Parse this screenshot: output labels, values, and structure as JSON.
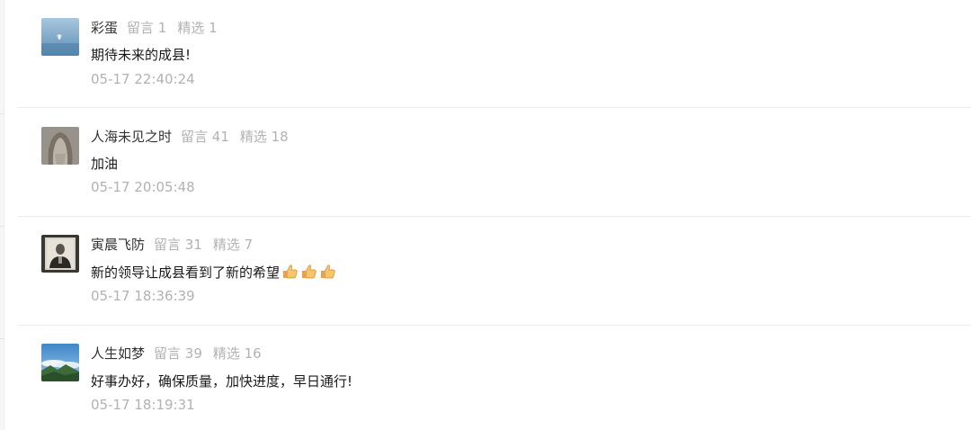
{
  "comments": [
    {
      "avatar_icon": "seagull-over-water-icon",
      "nickname": "彩蛋",
      "comment_count": "留言 1",
      "featured_count": "精选 1",
      "content": "期待未来的成县!",
      "time": "05-17 22:40:24"
    },
    {
      "avatar_icon": "long-hair-portrait-icon",
      "nickname": "人海未见之时",
      "comment_count": "留言 41",
      "featured_count": "精选 18",
      "content": "加油",
      "time": "05-17 20:05:48"
    },
    {
      "avatar_icon": "old-photo-portrait-icon",
      "nickname": "寅晨飞防",
      "comment_count": "留言 31",
      "featured_count": "精选 7",
      "content": "新的领导让成县看到了新的希望",
      "emoji_icon": "thumbs-up-icon",
      "emoji_count": 3,
      "time": "05-17 18:36:39"
    },
    {
      "avatar_icon": "mountain-clouds-landscape-icon",
      "nickname": "人生如梦",
      "comment_count": "留言 39",
      "featured_count": "精选 16",
      "content": "好事办好，确保质量，加快进度，早日通行!",
      "time": "05-17 18:19:31"
    }
  ],
  "colors": {
    "nickname": "#333333",
    "meta_gray": "#b2b2b2",
    "content_text": "#1a1a1a",
    "divider": "#ececec"
  }
}
